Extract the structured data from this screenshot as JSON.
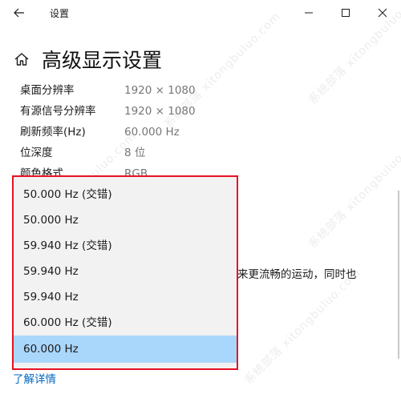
{
  "titlebar": {
    "title": "设置",
    "back_icon": "arrow-left-icon",
    "minimize_icon": "minimize-icon",
    "maximize_icon": "maximize-icon",
    "close_icon": "close-icon"
  },
  "header": {
    "title": "高级显示设置",
    "icon": "home-icon"
  },
  "info_rows": [
    {
      "label": "桌面分辨率",
      "value": "1920 × 1080"
    },
    {
      "label": "有源信号分辨率",
      "value": "1920 × 1080"
    },
    {
      "label": "刷新频率(Hz)",
      "value": "60.000 Hz"
    },
    {
      "label": "位深度",
      "value": "8 位"
    },
    {
      "label": "颜色格式",
      "value": "RGB"
    }
  ],
  "dropdown": {
    "selected_index": 6,
    "options": [
      "50.000 Hz (交错)",
      "50.000 Hz",
      "59.940 Hz (交错)",
      "59.940 Hz",
      "59.940 Hz",
      "60.000 Hz (交错)",
      "60.000 Hz"
    ]
  },
  "background_text": {
    "description_fragment": "来更流畅的运动，同时也",
    "learn_more": "了解详情"
  },
  "watermark": {
    "text": "系统部落 xitongbuluo.com"
  },
  "colors": {
    "highlight_border": "#e81123",
    "selected_bg": "#a9d6fb",
    "link": "#0067c0",
    "value_text": "#767676"
  }
}
